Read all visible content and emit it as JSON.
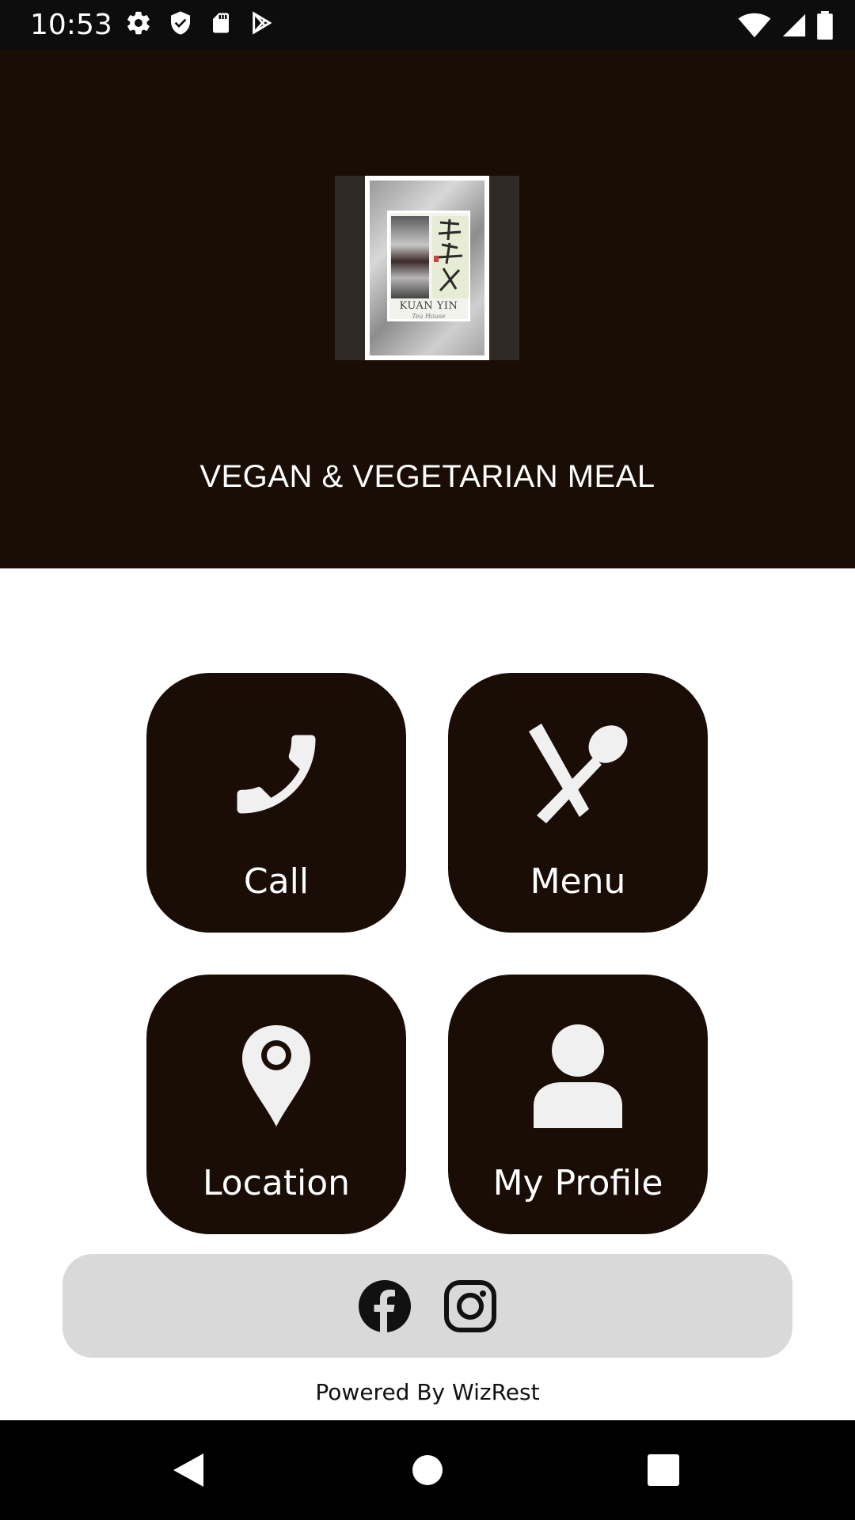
{
  "status_bar": {
    "time": "10:53",
    "icons_left": [
      "settings-icon",
      "shield-icon",
      "sd-card-icon",
      "play-store-icon"
    ],
    "icons_right": [
      "wifi-icon",
      "signal-icon",
      "battery-icon"
    ]
  },
  "header": {
    "logo": {
      "name_text": "KUAN YIN",
      "sub_text": "Tea House"
    },
    "tagline": "VEGAN & VEGETARIAN MEAL"
  },
  "tiles": [
    {
      "label": "Call",
      "icon": "phone-icon"
    },
    {
      "label": "Menu",
      "icon": "utensils-icon"
    },
    {
      "label": "Location",
      "icon": "map-pin-icon"
    },
    {
      "label": "My Profile",
      "icon": "user-icon"
    }
  ],
  "social": [
    "facebook-icon",
    "instagram-icon"
  ],
  "footer": {
    "powered_by": "Powered By WizRest"
  },
  "nav": [
    "back-icon",
    "home-icon",
    "recents-icon"
  ],
  "colors": {
    "brand_dark": "#1a0d05",
    "social_bar_bg": "#d9d9d9",
    "icon_light": "#f0f0f0"
  }
}
